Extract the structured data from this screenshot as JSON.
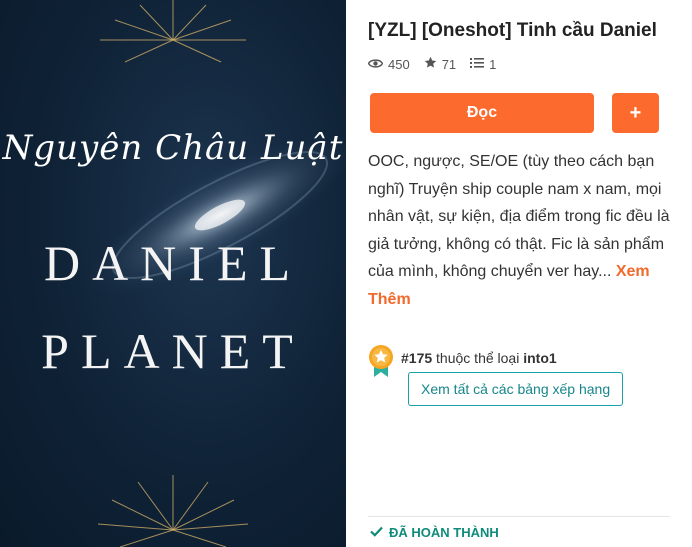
{
  "cover": {
    "author": "Nguyên Châu Luật",
    "title_line1": "DANIEL",
    "title_line2": "PLANET"
  },
  "story": {
    "title": "[YZL] [Oneshot] Tinh cầu Daniel",
    "views": "450",
    "votes": "71",
    "parts": "1",
    "read_label": "Đọc",
    "add_label": "+",
    "description": "OOC, ngược, SE/OE (tùy theo cách bạn nghĩ) Truyện ship couple nam x nam, mọi nhân vật, sự kiện, địa điểm trong fic đều là giả tưởng, không có thật. Fic là sản phẩm của mình, không chuyển ver hay...",
    "read_more": "Xem Thêm"
  },
  "ranking": {
    "rank": "#175",
    "middle": "thuộc thể loại",
    "tag": "into1",
    "button_label": "Xem tất cả các bảng xếp hạng"
  },
  "status": {
    "label": "ĐÃ HOÀN THÀNH"
  },
  "colors": {
    "accent": "#fd6a2e",
    "teal": "#18a2a6",
    "complete": "#0e8b7a"
  },
  "icons": [
    "eye-icon",
    "star-icon",
    "list-icon",
    "medal-icon",
    "check-icon"
  ]
}
